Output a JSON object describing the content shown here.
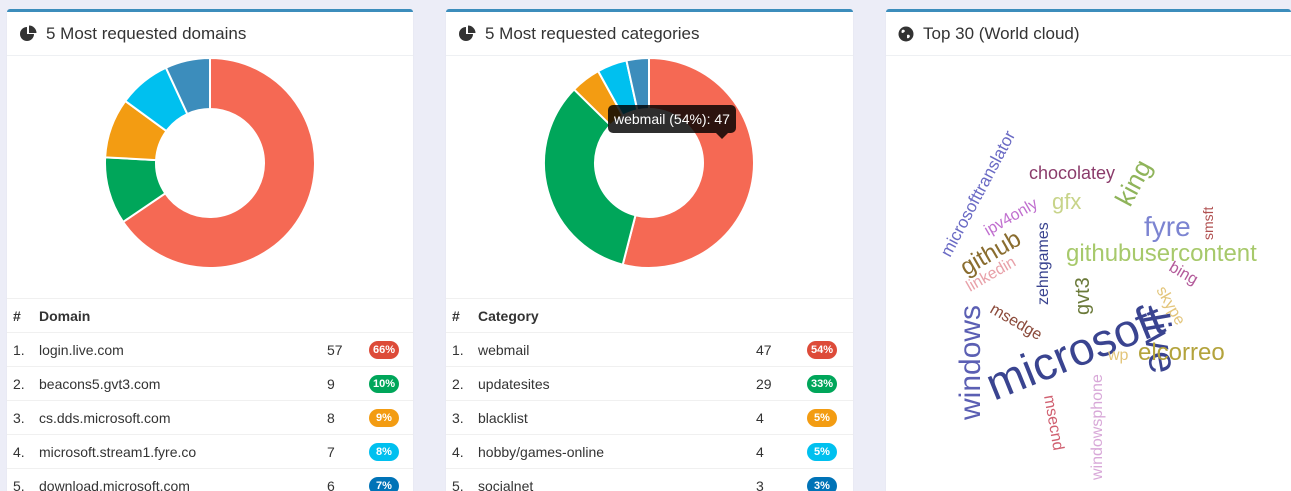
{
  "panels": {
    "domains": {
      "title": "5 Most requested domains",
      "col_num": "#",
      "col_name": "Domain",
      "rows": [
        {
          "num": "1.",
          "name": "login.live.com",
          "count": "57",
          "pct": "66%",
          "color": "#dd4b39"
        },
        {
          "num": "2.",
          "name": "beacons5.gvt3.com",
          "count": "9",
          "pct": "10%",
          "color": "#00a65a"
        },
        {
          "num": "3.",
          "name": "cs.dds.microsoft.com",
          "count": "8",
          "pct": "9%",
          "color": "#f39c12"
        },
        {
          "num": "4.",
          "name": "microsoft.stream1.fyre.co",
          "count": "7",
          "pct": "8%",
          "color": "#00c0ef"
        },
        {
          "num": "5.",
          "name": "download.microsoft.com",
          "count": "6",
          "pct": "7%",
          "color": "#0073b7"
        }
      ],
      "chart": {
        "values": [
          57,
          9,
          8,
          7,
          6
        ],
        "colors": [
          "#f56954",
          "#00a65a",
          "#f39c12",
          "#00c0ef",
          "#3c8dbc"
        ]
      }
    },
    "categories": {
      "title": "5 Most requested categories",
      "col_num": "#",
      "col_name": "Category",
      "tooltip": "webmail (54%): 47",
      "rows": [
        {
          "num": "1.",
          "name": "webmail",
          "count": "47",
          "pct": "54%",
          "color": "#dd4b39"
        },
        {
          "num": "2.",
          "name": "updatesites",
          "count": "29",
          "pct": "33%",
          "color": "#00a65a"
        },
        {
          "num": "3.",
          "name": "blacklist",
          "count": "4",
          "pct": "5%",
          "color": "#f39c12"
        },
        {
          "num": "4.",
          "name": "hobby/games-online",
          "count": "4",
          "pct": "5%",
          "color": "#00c0ef"
        },
        {
          "num": "5.",
          "name": "socialnet",
          "count": "3",
          "pct": "3%",
          "color": "#0073b7"
        }
      ],
      "chart": {
        "values": [
          47,
          29,
          4,
          4,
          3
        ],
        "colors": [
          "#f56954",
          "#00a65a",
          "#f39c12",
          "#00c0ef",
          "#3c8dbc"
        ]
      }
    },
    "cloud": {
      "title": "Top 30 (World cloud)",
      "words": [
        {
          "text": "microsoft",
          "color": "#3a4490"
        },
        {
          "text": "live",
          "color": "#3a4490"
        },
        {
          "text": "windows",
          "color": "#5b5fb3"
        },
        {
          "text": "githubusercontent",
          "color": "#a7c96b"
        },
        {
          "text": "elcorreo",
          "color": "#b3a33c"
        },
        {
          "text": "fyre",
          "color": "#7c84d1"
        },
        {
          "text": "microsofttranslator",
          "color": "#6a6ac4"
        },
        {
          "text": "chocolatey",
          "color": "#8b3c6b"
        },
        {
          "text": "king",
          "color": "#8fb45a"
        },
        {
          "text": "github",
          "color": "#8a6d2f"
        },
        {
          "text": "gfx",
          "color": "#c8d48a"
        },
        {
          "text": "ipv4only",
          "color": "#c06fcf"
        },
        {
          "text": "zehngames",
          "color": "#3a4490"
        },
        {
          "text": "gvt3",
          "color": "#6b7a3a"
        },
        {
          "text": "linkedin",
          "color": "#e8a0a8"
        },
        {
          "text": "msedge",
          "color": "#8b4a3a"
        },
        {
          "text": "bing",
          "color": "#b35a9a"
        },
        {
          "text": "skype",
          "color": "#e3c57a"
        },
        {
          "text": "smsft",
          "color": "#b05050"
        },
        {
          "text": "wp",
          "color": "#e3c57a"
        },
        {
          "text": "msecnd",
          "color": "#d06070"
        },
        {
          "text": "windowsphone",
          "color": "#d8a8d8"
        }
      ]
    }
  }
}
